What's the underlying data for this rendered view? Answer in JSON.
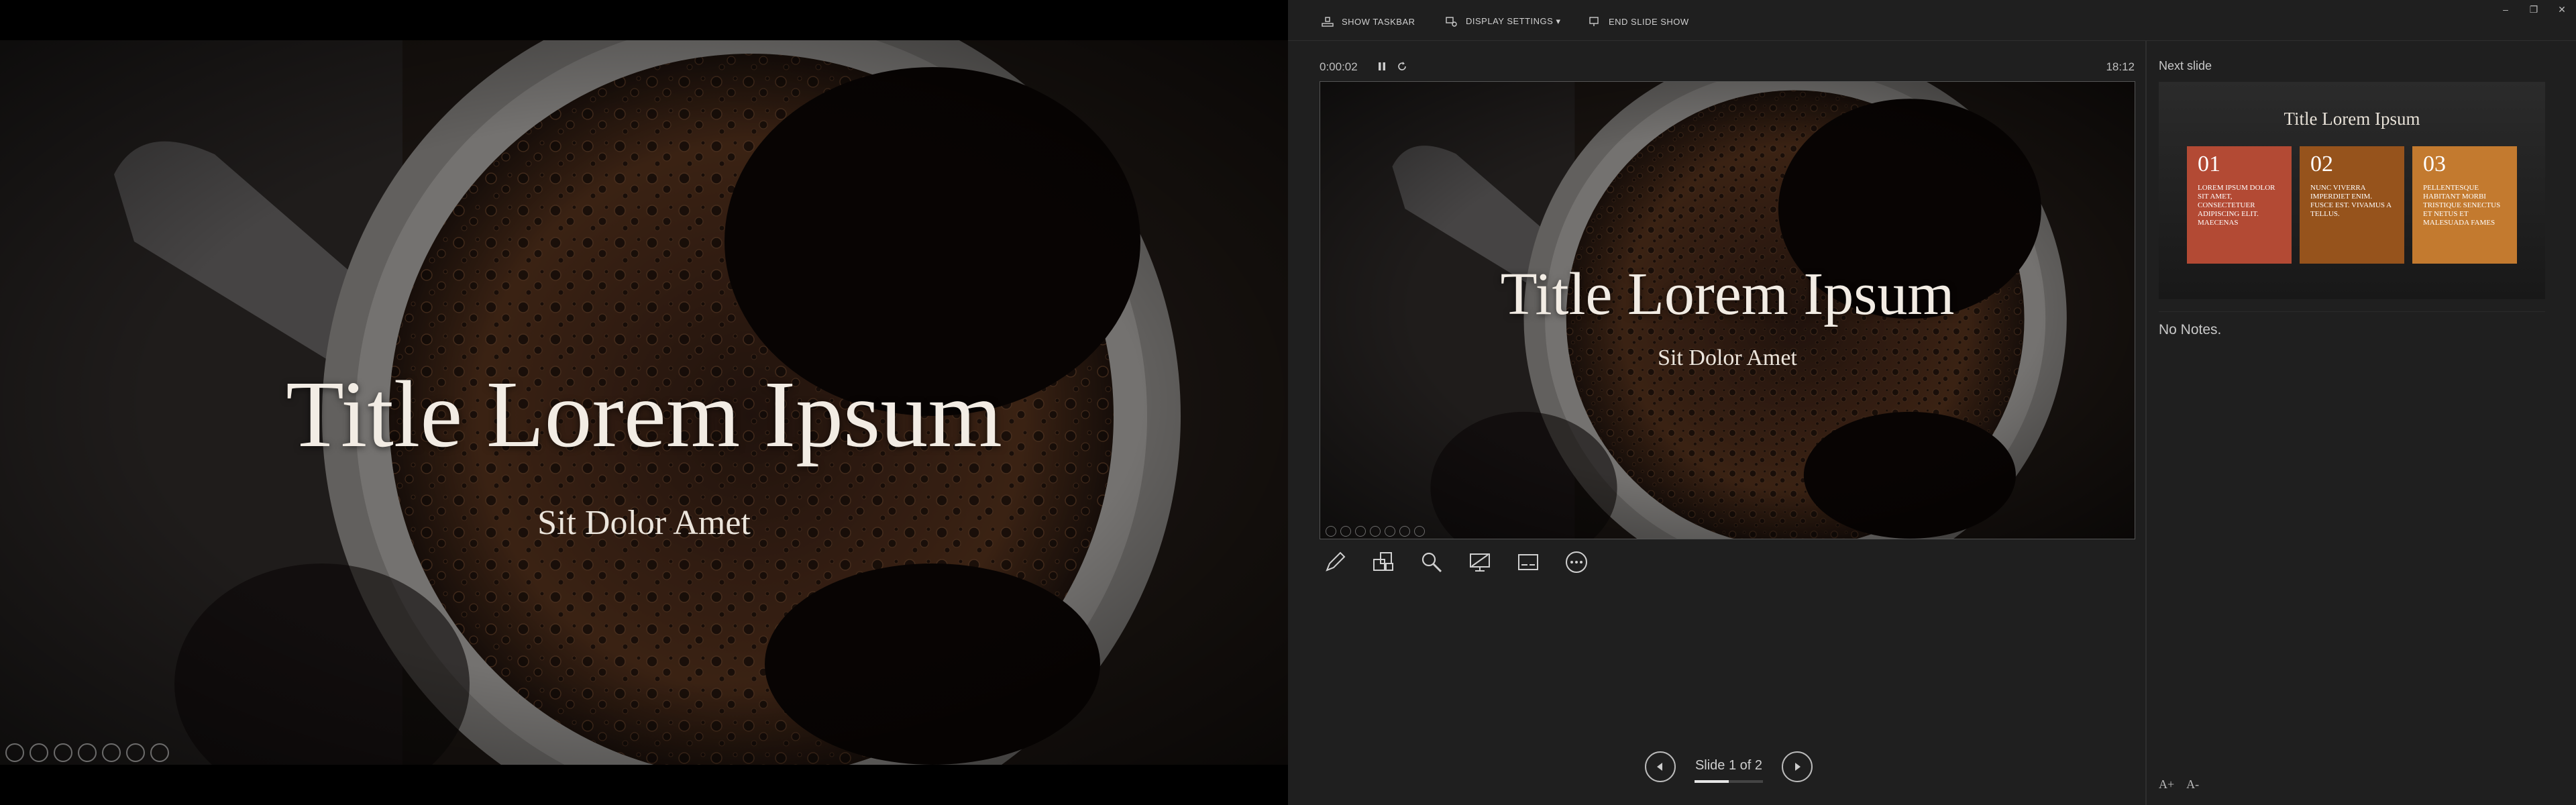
{
  "audience": {
    "slide": {
      "title": "Title Lorem Ipsum",
      "subtitle": "Sit Dolor Amet"
    }
  },
  "presenter": {
    "toolbar": {
      "show_taskbar": "SHOW TASKBAR",
      "display_settings": "DISPLAY SETTINGS ▾",
      "end_show": "END SLIDE SHOW"
    },
    "window_controls": {
      "minimize": "–",
      "restore": "❐",
      "close": "✕"
    },
    "timer": "0:00:02",
    "clock": "18:12",
    "current_slide": {
      "title": "Title Lorem Ipsum",
      "subtitle": "Sit Dolor Amet"
    },
    "tools": [
      "pen-icon",
      "see-all-slides-icon",
      "zoom-icon",
      "black-screen-icon",
      "subtitles-icon",
      "more-options-icon"
    ],
    "navigation": {
      "counter": "Slide 1 of 2",
      "progress": 0.5
    },
    "next_slide": {
      "label": "Next slide",
      "title": "Title Lorem Ipsum",
      "cards": [
        {
          "num": "01",
          "text": "Lorem ipsum dolor sit amet, consectetuer adipiscing elit. Maecenas",
          "color": "#b34a34"
        },
        {
          "num": "02",
          "text": "Nunc viverra imperdiet enim. Fusce est. Vivamus a tellus.",
          "color": "#96531c"
        },
        {
          "num": "03",
          "text": "Pellentesque habitant morbi tristique senectus et netus et malesuada fames",
          "color": "#c37a2f"
        }
      ]
    },
    "notes": "No Notes.",
    "font_controls": {
      "increase": "A+",
      "decrease": "A-"
    }
  }
}
